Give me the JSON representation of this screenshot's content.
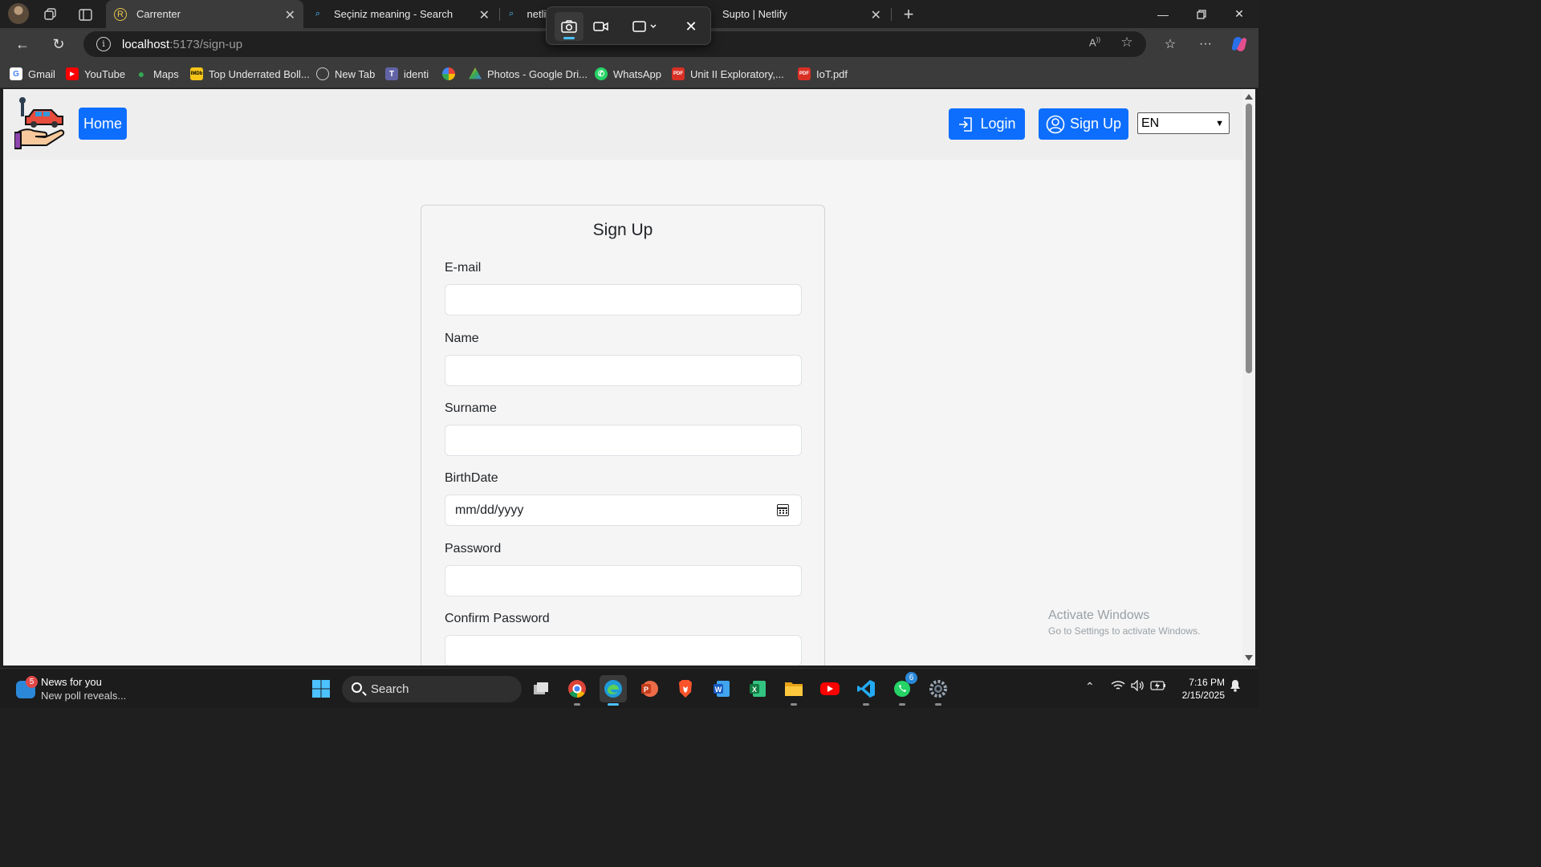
{
  "browser": {
    "tabs": [
      {
        "title": "Carrenter",
        "active": true
      },
      {
        "title": "Seçiniz meaning - Search",
        "active": false
      },
      {
        "title": "netlif",
        "active": false
      },
      {
        "title": "Supto | Netlify",
        "active": false
      }
    ],
    "address": {
      "host": "localhost",
      "path": ":5173/sign-up"
    },
    "bookmarks": [
      {
        "label": "Gmail",
        "icon": "google-icon",
        "color": "#4285f4"
      },
      {
        "label": "YouTube",
        "icon": "youtube-icon",
        "color": "#ff0000"
      },
      {
        "label": "Maps",
        "icon": "maps-pin-icon",
        "color": "#34a853"
      },
      {
        "label": "Top Underrated Boll...",
        "icon": "imdb-icon",
        "color": "#f5c518"
      },
      {
        "label": "New Tab",
        "icon": "globe-icon",
        "color": "#cccccc"
      },
      {
        "label": "identi",
        "icon": "teams-icon",
        "color": "#6264a7"
      },
      {
        "label": "",
        "icon": "pinwheel-icon",
        "color": "#ea4335"
      },
      {
        "label": "Photos - Google Dri...",
        "icon": "google-drive-icon",
        "color": "#fbbc04"
      },
      {
        "label": "WhatsApp",
        "icon": "whatsapp-icon",
        "color": "#25d366"
      },
      {
        "label": "Unit II Exploratory,...",
        "icon": "pdf-icon",
        "color": "#d93025"
      },
      {
        "label": "IoT.pdf",
        "icon": "pdf-icon",
        "color": "#d93025"
      }
    ]
  },
  "page": {
    "nav": {
      "home": "Home",
      "login": "Login",
      "signup": "Sign Up",
      "language": "EN"
    },
    "form": {
      "title": "Sign Up",
      "fields": [
        {
          "label": "E-mail",
          "value": ""
        },
        {
          "label": "Name",
          "value": ""
        },
        {
          "label": "Surname",
          "value": ""
        },
        {
          "label": "BirthDate",
          "value": "mm/dd/yyyy"
        },
        {
          "label": "Password",
          "value": ""
        },
        {
          "label": "Confirm Password",
          "value": ""
        }
      ]
    },
    "watermark": {
      "line1": "Activate Windows",
      "line2": "Go to Settings to activate Windows."
    }
  },
  "taskbar": {
    "news_title": "News for you",
    "news_sub": "New poll reveals...",
    "news_badge": "5",
    "search": "Search",
    "whatsapp_badge": "6",
    "time": "7:16 PM",
    "date": "2/15/2025"
  },
  "colors": {
    "primary": "#0d6efd",
    "page_bg": "#f5f5f5",
    "navbar_bg": "#eeeeee"
  }
}
